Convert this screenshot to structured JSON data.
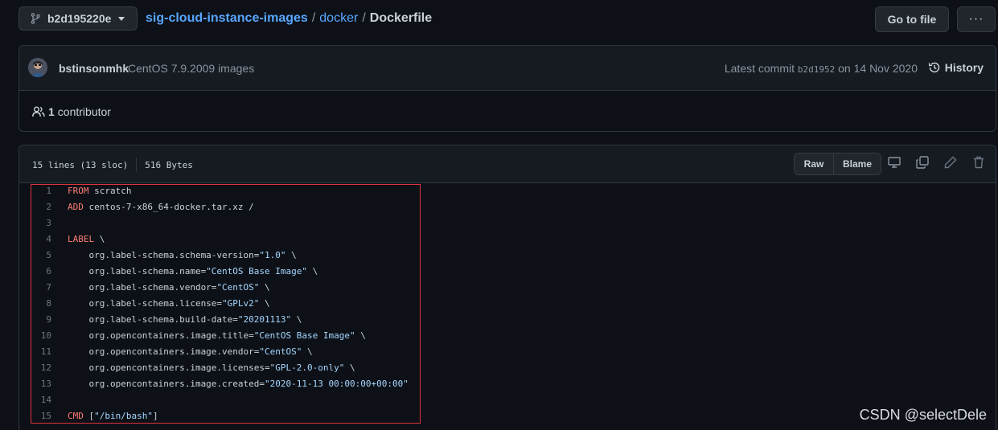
{
  "topbar": {
    "branch": "b2d195220e",
    "crumbs": {
      "repo": "sig-cloud-instance-images",
      "sep1": "/",
      "folder": "docker",
      "sep2": "/",
      "file": "Dockerfile"
    },
    "goto_label": "Go to file",
    "more_label": "···"
  },
  "commit": {
    "author": "bstinsonmhk",
    "message": "CentOS 7.9.2009 images",
    "latest_prefix": "Latest commit",
    "sha": "b2d1952",
    "date_text": "on 14 Nov 2020",
    "history_label": "History",
    "contributors_count": "1",
    "contributors_label": "contributor"
  },
  "file": {
    "lines_info": "15 lines (13 sloc)",
    "size_info": "516 Bytes",
    "raw_label": "Raw",
    "blame_label": "Blame"
  },
  "code": [
    {
      "n": "1",
      "kw": "FROM",
      "rest": " scratch",
      "str": "",
      "tail": ""
    },
    {
      "n": "2",
      "kw": "ADD",
      "rest": " centos-7-x86_64-docker.tar.xz /",
      "str": "",
      "tail": ""
    },
    {
      "n": "3",
      "kw": "",
      "rest": "",
      "str": "",
      "tail": ""
    },
    {
      "n": "4",
      "kw": "LABEL",
      "rest": " \\",
      "str": "",
      "tail": ""
    },
    {
      "n": "5",
      "kw": "",
      "rest": "    org.label-schema.schema-version=",
      "str": "\"1.0\"",
      "tail": " \\"
    },
    {
      "n": "6",
      "kw": "",
      "rest": "    org.label-schema.name=",
      "str": "\"CentOS Base Image\"",
      "tail": " \\"
    },
    {
      "n": "7",
      "kw": "",
      "rest": "    org.label-schema.vendor=",
      "str": "\"CentOS\"",
      "tail": " \\"
    },
    {
      "n": "8",
      "kw": "",
      "rest": "    org.label-schema.license=",
      "str": "\"GPLv2\"",
      "tail": " \\"
    },
    {
      "n": "9",
      "kw": "",
      "rest": "    org.label-schema.build-date=",
      "str": "\"20201113\"",
      "tail": " \\"
    },
    {
      "n": "10",
      "kw": "",
      "rest": "    org.opencontainers.image.title=",
      "str": "\"CentOS Base Image\"",
      "tail": " \\"
    },
    {
      "n": "11",
      "kw": "",
      "rest": "    org.opencontainers.image.vendor=",
      "str": "\"CentOS\"",
      "tail": " \\"
    },
    {
      "n": "12",
      "kw": "",
      "rest": "    org.opencontainers.image.licenses=",
      "str": "\"GPL-2.0-only\"",
      "tail": " \\"
    },
    {
      "n": "13",
      "kw": "",
      "rest": "    org.opencontainers.image.created=",
      "str": "\"2020-11-13 00:00:00+00:00\"",
      "tail": ""
    },
    {
      "n": "14",
      "kw": "",
      "rest": "",
      "str": "",
      "tail": ""
    },
    {
      "n": "15",
      "kw": "CMD",
      "rest": " [",
      "str": "\"/bin/bash\"",
      "tail": "]"
    }
  ],
  "watermark": "CSDN @selectDele",
  "colors": {
    "background": "#0d1117",
    "link": "#58a6ff",
    "keyword": "#ff7b72",
    "string": "#a5d6ff",
    "highlight_border": "#e0323c"
  }
}
